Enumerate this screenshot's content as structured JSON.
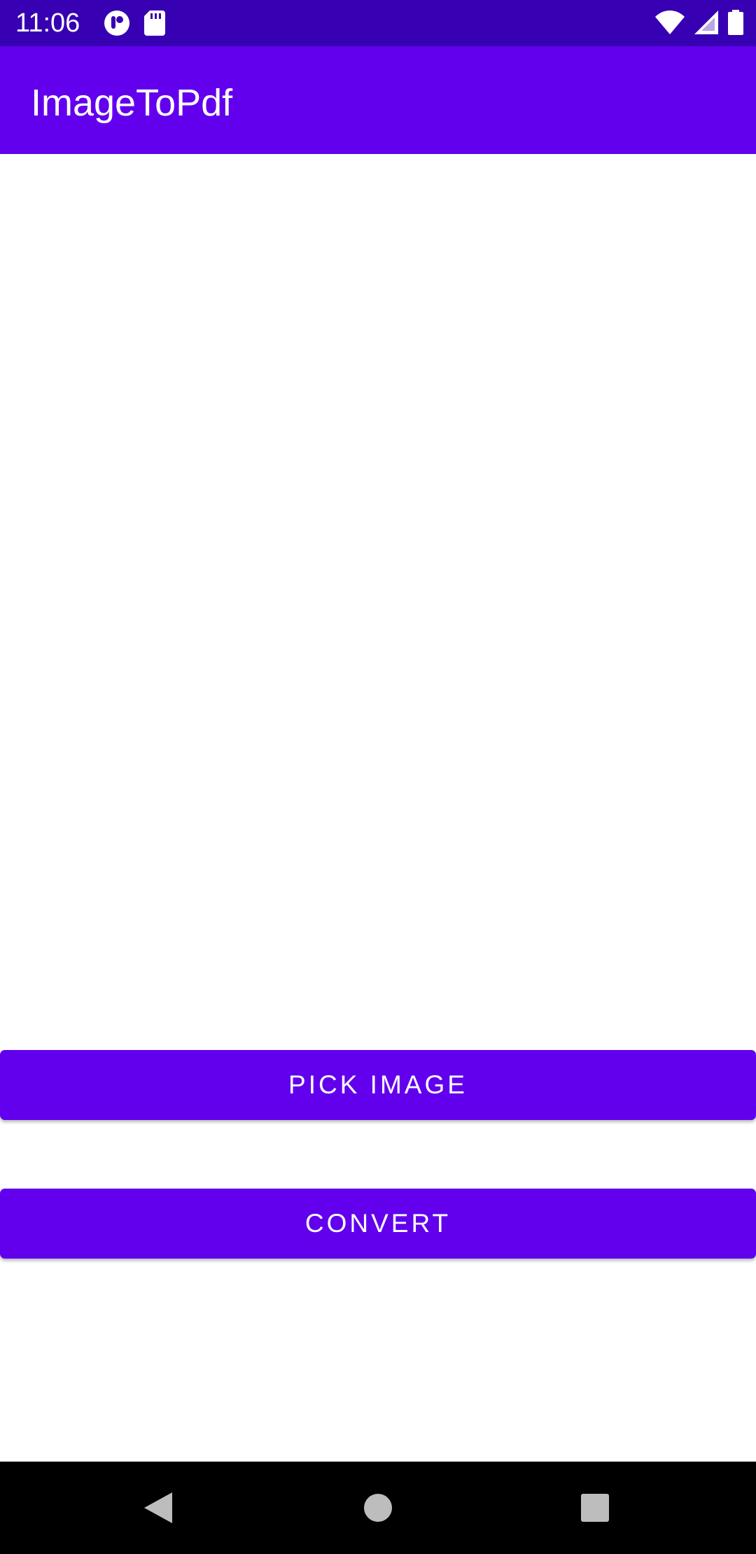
{
  "status_bar": {
    "time": "11:06",
    "left_icons": [
      "notification-app-icon",
      "sd-card-icon"
    ],
    "right_icons": [
      "wifi-icon",
      "cell-signal-icon",
      "battery-icon"
    ]
  },
  "app_bar": {
    "title": "ImageToPdf"
  },
  "main": {
    "pick_image_label": "PICK IMAGE",
    "convert_label": "CONVERT"
  },
  "nav_bar": {
    "icons": [
      "back-icon",
      "home-icon",
      "recents-icon"
    ]
  },
  "colors": {
    "status_bar": "#3700b3",
    "primary": "#6200ee",
    "background": "#ffffff",
    "nav_bar": "#000000",
    "nav_icon": "#bdbdbd"
  }
}
